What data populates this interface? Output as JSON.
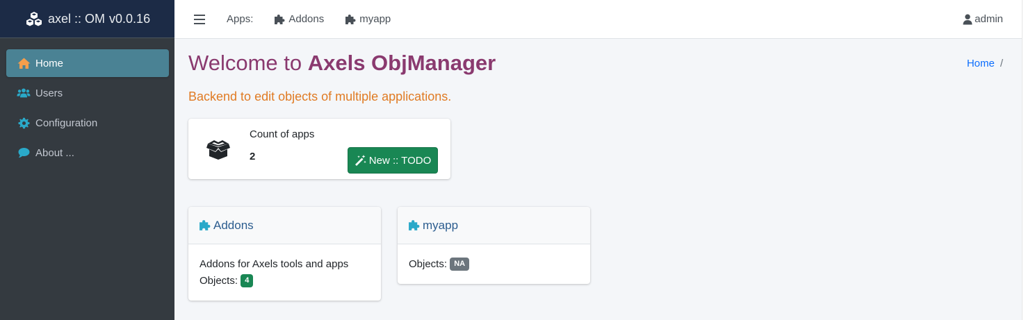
{
  "brand": {
    "name": "axel :: OM",
    "version": "v0.0.16",
    "icon": "cubes-icon"
  },
  "sidebar": {
    "items": [
      {
        "label": "Home",
        "icon": "home-icon",
        "active": true
      },
      {
        "label": "Users",
        "icon": "users-icon",
        "active": false
      },
      {
        "label": "Configuration",
        "icon": "gear-icon",
        "active": false
      },
      {
        "label": "About ...",
        "icon": "comment-icon",
        "active": false
      }
    ]
  },
  "topbar": {
    "apps_label": "Apps:",
    "links": [
      {
        "label": "Addons",
        "icon": "puzzle-icon"
      },
      {
        "label": "myapp",
        "icon": "puzzle-icon"
      }
    ],
    "user": "admin"
  },
  "page": {
    "title_prefix": "Welcome to ",
    "title_bold": "Axels ObjManager",
    "subtitle": "Backend to edit objects of multiple applications.",
    "breadcrumb": {
      "home": "Home",
      "separator": "/"
    }
  },
  "info_box": {
    "label": "Count of apps",
    "value": "2",
    "icon": "box-open-icon",
    "button_label": "New :: TODO"
  },
  "apps": [
    {
      "name": "Addons",
      "description": "Addons for Axels tools and apps",
      "objects_label": "Objects:",
      "objects_count": "4",
      "badge_color": "#198754"
    },
    {
      "name": "myapp",
      "description": "",
      "objects_label": "Objects:",
      "objects_count": "NA",
      "badge_color": "#6c757d"
    }
  ],
  "colors": {
    "sidebar_bg": "#343a40",
    "brand_bg": "#1c2b46",
    "active_item": "#4a8294",
    "title": "#8a3a6f",
    "subtitle": "#e07b24",
    "success": "#198754",
    "home_icon": "#f59e4c",
    "nav_icon": "#2aa9c9"
  }
}
